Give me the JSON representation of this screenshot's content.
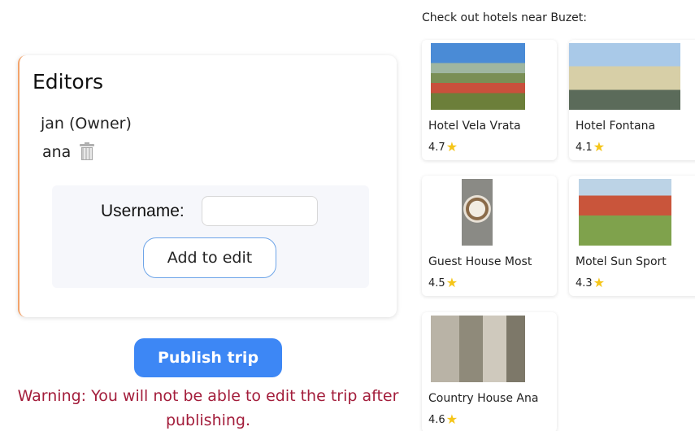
{
  "editors": {
    "title": "Editors",
    "list": [
      {
        "name": "jan (Owner)",
        "removable": false
      },
      {
        "name": "ana",
        "removable": true
      }
    ],
    "username_label": "Username:",
    "username_value": "",
    "add_label": "Add to edit"
  },
  "publish": {
    "label": "Publish trip",
    "warning": "Warning: You will not be able to edit the trip after publishing."
  },
  "hotels": {
    "heading": "Check out hotels near Buzet:",
    "items": [
      {
        "name": "Hotel Vela Vrata",
        "rating": "4.7"
      },
      {
        "name": "Hotel Fontana",
        "rating": "4.1"
      },
      {
        "name": "Guest House Most",
        "rating": "4.5"
      },
      {
        "name": "Motel Sun Sport",
        "rating": "4.3"
      },
      {
        "name": "Country House Ana",
        "rating": "4.6"
      }
    ]
  },
  "icons": {
    "trash": "trash-icon",
    "star": "star-icon"
  },
  "colors": {
    "accent": "#3d87f5",
    "warning": "#a31d3b",
    "card_border": "#f2a36b",
    "star": "#f5c518"
  }
}
